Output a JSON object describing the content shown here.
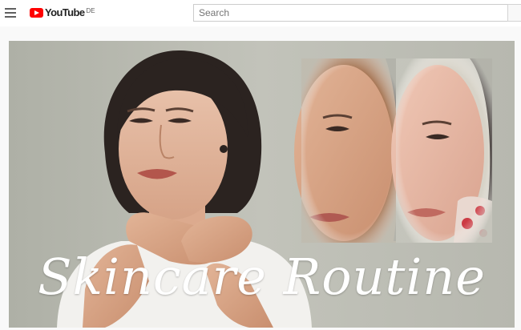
{
  "header": {
    "brand": "YouTube",
    "region": "DE",
    "search": {
      "placeholder": "Search",
      "value": ""
    },
    "icons": {
      "menu": "hamburger-menu-icon",
      "logo": "youtube-logo-icon"
    }
  },
  "video": {
    "thumbnail_title": "Skincare Routine"
  },
  "colors": {
    "brand_red": "#ff0000",
    "topbar": "#ffffff",
    "page_bg": "#f9f9f9"
  }
}
